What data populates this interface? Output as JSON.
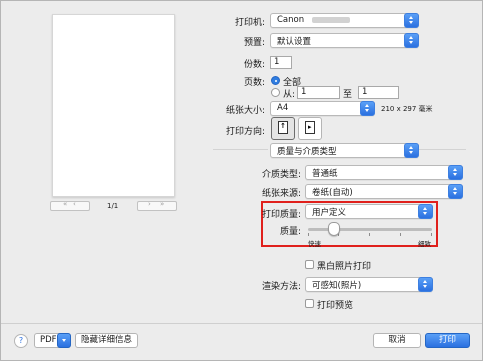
{
  "printer": {
    "label": "打印机:",
    "value": "Canon"
  },
  "presets": {
    "label": "预置:",
    "value": "默认设置"
  },
  "copies": {
    "label": "份数:",
    "value": "1"
  },
  "pages": {
    "label": "页数:",
    "all_label": "全部",
    "from_label": "从:",
    "from_value": "1",
    "to_label": "至",
    "to_value": "1"
  },
  "paper_size": {
    "label": "纸张大小:",
    "value": "A4",
    "dimensions": "210 x 297 毫米"
  },
  "orientation": {
    "label": "打印方向:"
  },
  "section": {
    "value": "质量与介质类型"
  },
  "media_type": {
    "label": "介质类型:",
    "value": "普通纸"
  },
  "paper_source": {
    "label": "纸张来源:",
    "value": "卷纸(自动)"
  },
  "print_quality": {
    "label": "打印质量:",
    "value": "用户定义"
  },
  "quality": {
    "label": "质量:",
    "min_label": "快速",
    "max_label": "细致",
    "level": 0.2
  },
  "grayscale": {
    "label": "黑白照片打印"
  },
  "rendering": {
    "label": "渲染方法:",
    "value": "可感知(照片)"
  },
  "preview": {
    "label": "打印预览"
  },
  "preview_nav": {
    "page_indicator": "1/1"
  },
  "footer": {
    "help": "?",
    "pdf": "PDF",
    "hide_details": "隐藏详细信息",
    "cancel": "取消",
    "print": "打印"
  },
  "colors": {
    "accent": "#2b70e0",
    "highlight": "#e0201c"
  }
}
